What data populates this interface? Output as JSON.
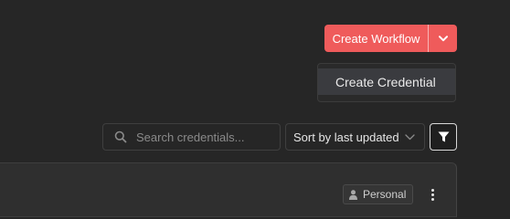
{
  "header": {
    "primary_action_label": "Create Workflow",
    "dropdown_toggle_icon": "chevron-down-icon",
    "accent_color": "#ef5b5b"
  },
  "dropdown_menu": {
    "items": [
      {
        "label": "Create Credential"
      }
    ]
  },
  "filters": {
    "search": {
      "placeholder": "Search credentials...",
      "value": "",
      "icon": "search-icon"
    },
    "sort": {
      "selected": "Sort by last updated",
      "icon": "chevron-down-icon"
    },
    "filter_button_icon": "filter-icon"
  },
  "card": {
    "badge_label": "Personal",
    "badge_icon": "user-icon",
    "menu_icon": "kebab-menu-icon"
  }
}
